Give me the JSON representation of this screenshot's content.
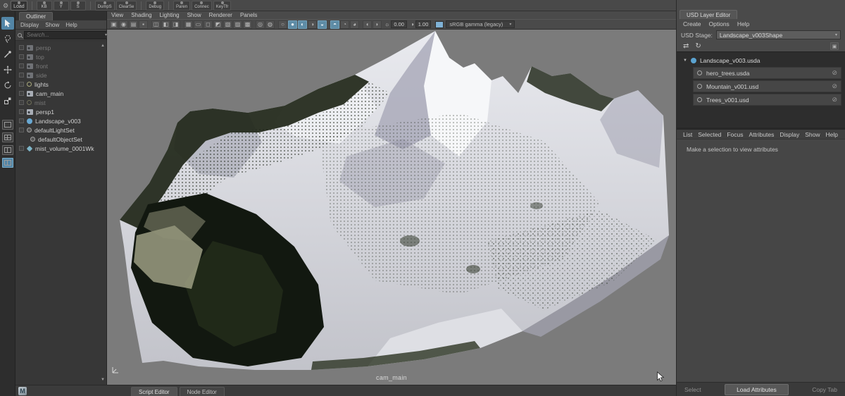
{
  "icons": {
    "gear-icon": "⚙",
    "dropdown-arrow": "▾",
    "expand-arrow": "▼",
    "scroll-up": "▲",
    "scroll-down": "▼",
    "sun-icon": "☼",
    "contrast-icon": "◑",
    "no-edit-icon": "⊘",
    "transfer-icon": "⇄",
    "revert-icon": "↻",
    "mute-layer-icon": "▣",
    "maya-logo": "M"
  },
  "shelf": {
    "load_label": "Load",
    "group1": [
      "KB",
      "Y",
      "S"
    ],
    "group2": [
      "DumpS",
      "ClearSe"
    ],
    "group3": [
      "Debug"
    ],
    "group4": [
      "Paren",
      "Connec",
      "KeyTfr"
    ]
  },
  "outliner": {
    "tab": "Outliner",
    "menus": [
      "Display",
      "Show",
      "Help"
    ],
    "search_placeholder": "Search...",
    "items": [
      {
        "label": "persp",
        "type": "camera",
        "muted": true
      },
      {
        "label": "top",
        "type": "camera",
        "muted": true
      },
      {
        "label": "front",
        "type": "camera",
        "muted": true
      },
      {
        "label": "side",
        "type": "camera",
        "muted": true
      },
      {
        "label": "lights",
        "type": "group",
        "muted": false
      },
      {
        "label": "cam_main",
        "type": "camera",
        "muted": false
      },
      {
        "label": "mist",
        "type": "group",
        "muted": true
      },
      {
        "label": "persp1",
        "type": "camera",
        "muted": false
      },
      {
        "label": "Landscape_v003",
        "type": "usd",
        "muted": false
      },
      {
        "label": "defaultLightSet",
        "type": "set",
        "muted": false
      },
      {
        "label": "defaultObjectSet",
        "type": "set",
        "muted": false,
        "indent": true
      },
      {
        "label": "mist_volume_0001Wk",
        "type": "volume",
        "muted": false
      }
    ]
  },
  "viewport": {
    "menus": [
      "View",
      "Shading",
      "Lighting",
      "Show",
      "Renderer",
      "Panels"
    ],
    "toolbar": [
      {
        "name": "select-camera-icon",
        "glyph": "▣"
      },
      {
        "name": "lock-camera-icon",
        "glyph": "◉"
      },
      {
        "name": "camera-attributes-icon",
        "glyph": "▤"
      },
      {
        "name": "bookmarks-icon",
        "glyph": "▪"
      },
      {
        "name": "toolbar-separator",
        "sep": true
      },
      {
        "name": "image-plane-icon",
        "glyph": "◫"
      },
      {
        "name": "2d-pan-zoom-icon",
        "glyph": "◧"
      },
      {
        "name": "grease-pencil-icon",
        "glyph": "◨"
      },
      {
        "name": "toolbar-separator",
        "sep": true
      },
      {
        "name": "grid-icon",
        "glyph": "▦"
      },
      {
        "name": "film-gate-icon",
        "glyph": "▭"
      },
      {
        "name": "resolution-gate-icon",
        "glyph": "◻"
      },
      {
        "name": "gate-mask-icon",
        "glyph": "◩"
      },
      {
        "name": "field-chart-icon",
        "glyph": "▧"
      },
      {
        "name": "safe-action-icon",
        "glyph": "▨"
      },
      {
        "name": "safe-title-icon",
        "glyph": "▩"
      },
      {
        "name": "toolbar-separator",
        "sep": true
      },
      {
        "name": "frame-all-icon",
        "glyph": "◎"
      },
      {
        "name": "frame-selection-icon",
        "glyph": "◍"
      },
      {
        "name": "toolbar-separator",
        "sep": true
      },
      {
        "name": "wireframe-icon",
        "glyph": "○"
      },
      {
        "name": "shaded-icon",
        "glyph": "●",
        "active": true
      },
      {
        "name": "textured-icon",
        "glyph": "◐",
        "active": true
      },
      {
        "name": "lights-icon",
        "glyph": "◑"
      },
      {
        "name": "shadows-icon",
        "glyph": "◒",
        "active": true
      },
      {
        "name": "toolbar-separator",
        "sep": true
      },
      {
        "name": "screen-space-ao-icon",
        "glyph": "◓",
        "active": true
      },
      {
        "name": "motion-blur-icon",
        "glyph": "◔"
      },
      {
        "name": "anti-alias-icon",
        "glyph": "◕"
      },
      {
        "name": "toolbar-separator",
        "sep": true
      },
      {
        "name": "xray-icon",
        "glyph": "◖"
      },
      {
        "name": "isolate-select-icon",
        "glyph": "◗"
      }
    ],
    "exposure": "0.00",
    "gamma": "1.00",
    "view_transform": "sRGB gamma (legacy)",
    "camera_label": "cam_main"
  },
  "usd_editor": {
    "tab": "USD Layer Editor",
    "menus": [
      "Create",
      "Options",
      "Help"
    ],
    "stage_label": "USD Stage:",
    "stage_value": "Landscape_v003Shape",
    "root_layer": "Landscape_v003.usda",
    "sublayers": [
      "hero_trees.usda",
      "Mountain_v001.usd",
      "Trees_v001.usd"
    ]
  },
  "attribute_editor": {
    "menus": [
      "List",
      "Selected",
      "Focus",
      "Attributes",
      "Display",
      "Show",
      "Help"
    ],
    "message": "Make a selection to view attributes",
    "buttons": [
      {
        "label": "Select",
        "dim": true
      },
      {
        "label": "Load Attributes",
        "primary": true
      },
      {
        "label": "Copy Tab",
        "dim": true
      }
    ]
  },
  "bottom_tabs": [
    {
      "label": "Script Editor",
      "active": true
    },
    {
      "label": "Node Editor",
      "active": false
    }
  ]
}
